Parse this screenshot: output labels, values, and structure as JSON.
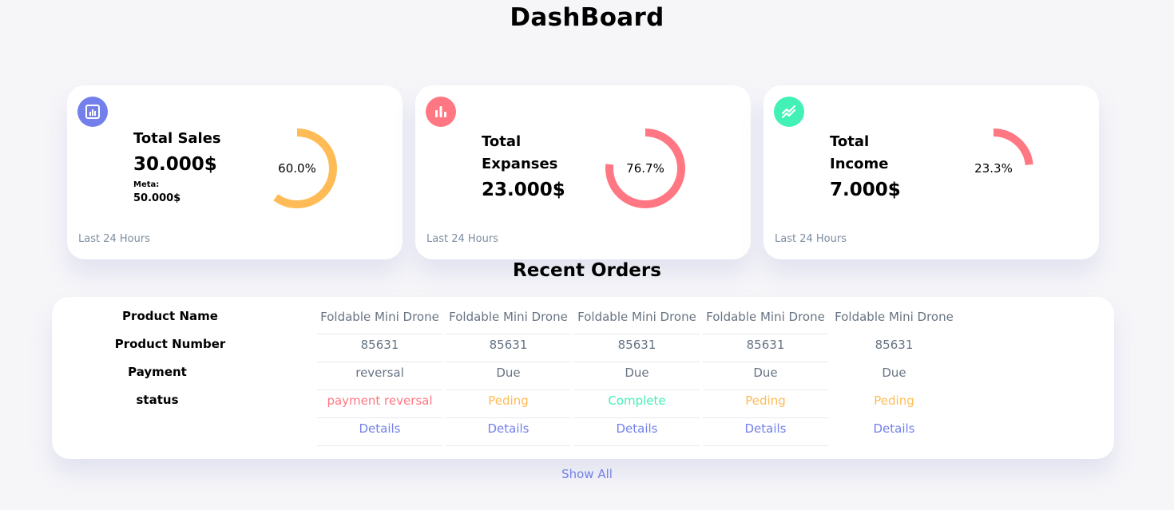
{
  "page_title": "DashBoard",
  "colors": {
    "primary": "#7380ec",
    "danger": "#ff7782",
    "success": "#41f1b6",
    "warning": "#ffbb55"
  },
  "cards": [
    {
      "icon": "bar-chart-icon",
      "title": "Total Sales",
      "amount": "30.000$",
      "meta_label": "Meta:",
      "meta_value": "50.000$",
      "percent_label": "60.0%",
      "percent": 60.0,
      "footer": "Last 24 Hours"
    },
    {
      "icon": "stats-icon",
      "title_line1": "Total",
      "title_line2": "Expanses",
      "amount": "23.000$",
      "percent_label": "76.7%",
      "percent": 76.7,
      "footer": "Last 24 Hours"
    },
    {
      "icon": "trending-icon",
      "title_line1": "Total",
      "title_line2": "Income",
      "amount": "7.000$",
      "percent_label": "23.3%",
      "percent": 23.3,
      "footer": "Last 24 Hours"
    }
  ],
  "recent_orders": {
    "title": "Recent Orders",
    "row_headers": [
      "Product Name",
      "Product Number",
      "Payment",
      "status"
    ],
    "columns": [
      {
        "name": "Foldable Mini Drone",
        "number": "85631",
        "payment": "reversal",
        "status": "payment reversal",
        "details": "Details"
      },
      {
        "name": "Foldable Mini Drone",
        "number": "85631",
        "payment": "Due",
        "status": "Peding",
        "details": "Details"
      },
      {
        "name": "Foldable Mini Drone",
        "number": "85631",
        "payment": "Due",
        "status": "Complete",
        "details": "Details"
      },
      {
        "name": "Foldable Mini Drone",
        "number": "85631",
        "payment": "Due",
        "status": "Peding",
        "details": "Details"
      },
      {
        "name": "Foldable Mini Drone",
        "number": "85631",
        "payment": "Due",
        "status": "Peding",
        "details": "Details"
      }
    ],
    "show_all": "Show All"
  }
}
